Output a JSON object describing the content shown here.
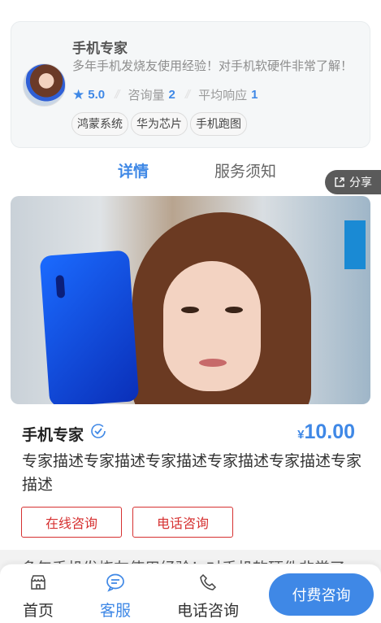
{
  "expert": {
    "name": "手机专家",
    "description": "多年手机发烧友使用经验！对手机软硬件非常了解！",
    "rating": "5.0",
    "consult_label": "咨询量",
    "consult_count": "2",
    "response_label": "平均响应",
    "response_value": "1",
    "tags": [
      "鸿蒙系统",
      "华为芯片",
      "手机跑图"
    ]
  },
  "tabs": [
    {
      "label": "详情",
      "active": true
    },
    {
      "label": "服务须知",
      "active": false
    }
  ],
  "share_label": "分享",
  "info": {
    "name": "手机专家",
    "currency": "¥",
    "price": "10.00",
    "description": "专家描述专家描述专家描述专家描述专家描述专家描述",
    "online_button": "在线咨询",
    "phone_button": "电话咨询",
    "background_text": "多年手机发烧友使用经验！对手机软硬件非常了"
  },
  "bottom_nav": {
    "home": "首页",
    "service": "客服",
    "call": "电话咨询",
    "pay": "付费咨询"
  },
  "colors": {
    "accent": "#3f88e6",
    "danger": "#d63131",
    "share_bg": "#5a5a5a"
  },
  "icons": [
    "star-icon",
    "share-icon",
    "verified-icon",
    "home-icon",
    "chat-icon",
    "phone-icon"
  ]
}
